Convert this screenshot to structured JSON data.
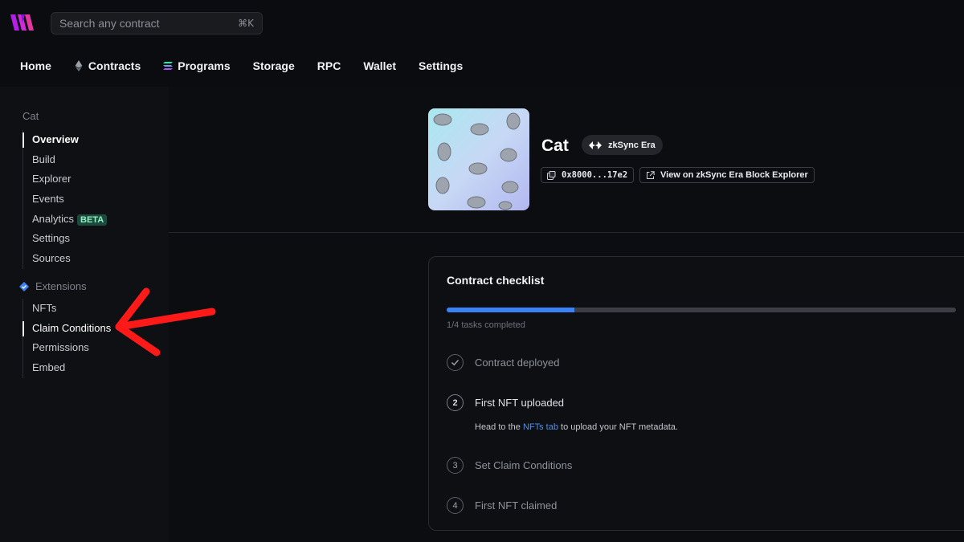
{
  "search": {
    "placeholder": "Search any contract",
    "shortcut": "⌘K"
  },
  "nav": [
    {
      "label": "Home",
      "icon": ""
    },
    {
      "label": "Contracts",
      "icon": "ethereum-icon"
    },
    {
      "label": "Programs",
      "icon": "solana-icon"
    },
    {
      "label": "Storage",
      "icon": ""
    },
    {
      "label": "RPC",
      "icon": ""
    },
    {
      "label": "Wallet",
      "icon": ""
    },
    {
      "label": "Settings",
      "icon": ""
    }
  ],
  "sidebar": {
    "contract_title": "Cat",
    "items": [
      {
        "label": "Overview"
      },
      {
        "label": "Build"
      },
      {
        "label": "Explorer"
      },
      {
        "label": "Events"
      },
      {
        "label": "Analytics",
        "badge": "BETA"
      },
      {
        "label": "Settings"
      },
      {
        "label": "Sources"
      }
    ],
    "extensions_title": "Extensions",
    "extensions": [
      {
        "label": "NFTs"
      },
      {
        "label": "Claim Conditions"
      },
      {
        "label": "Permissions"
      },
      {
        "label": "Embed"
      }
    ]
  },
  "contract": {
    "name": "Cat",
    "chain": "zkSync Era",
    "address": "0x8000...17e2",
    "explorer_link": "View on zkSync Era Block Explorer"
  },
  "checklist": {
    "title": "Contract checklist",
    "progress": 0.25,
    "progress_text": "1/4 tasks completed",
    "steps": [
      {
        "num": "",
        "label": "Contract deployed",
        "done": true
      },
      {
        "num": "2",
        "label": "First NFT uploaded",
        "current": true
      },
      {
        "num": "3",
        "label": "Set Claim Conditions"
      },
      {
        "num": "4",
        "label": "First NFT claimed"
      }
    ],
    "hint_prefix": "Head to the ",
    "hint_link": "NFTs tab",
    "hint_suffix": " to upload your NFT metadata."
  },
  "colors": {
    "accent": "#3b82f6",
    "arrow": "#ff1a1a",
    "logo": "#c026d3"
  }
}
